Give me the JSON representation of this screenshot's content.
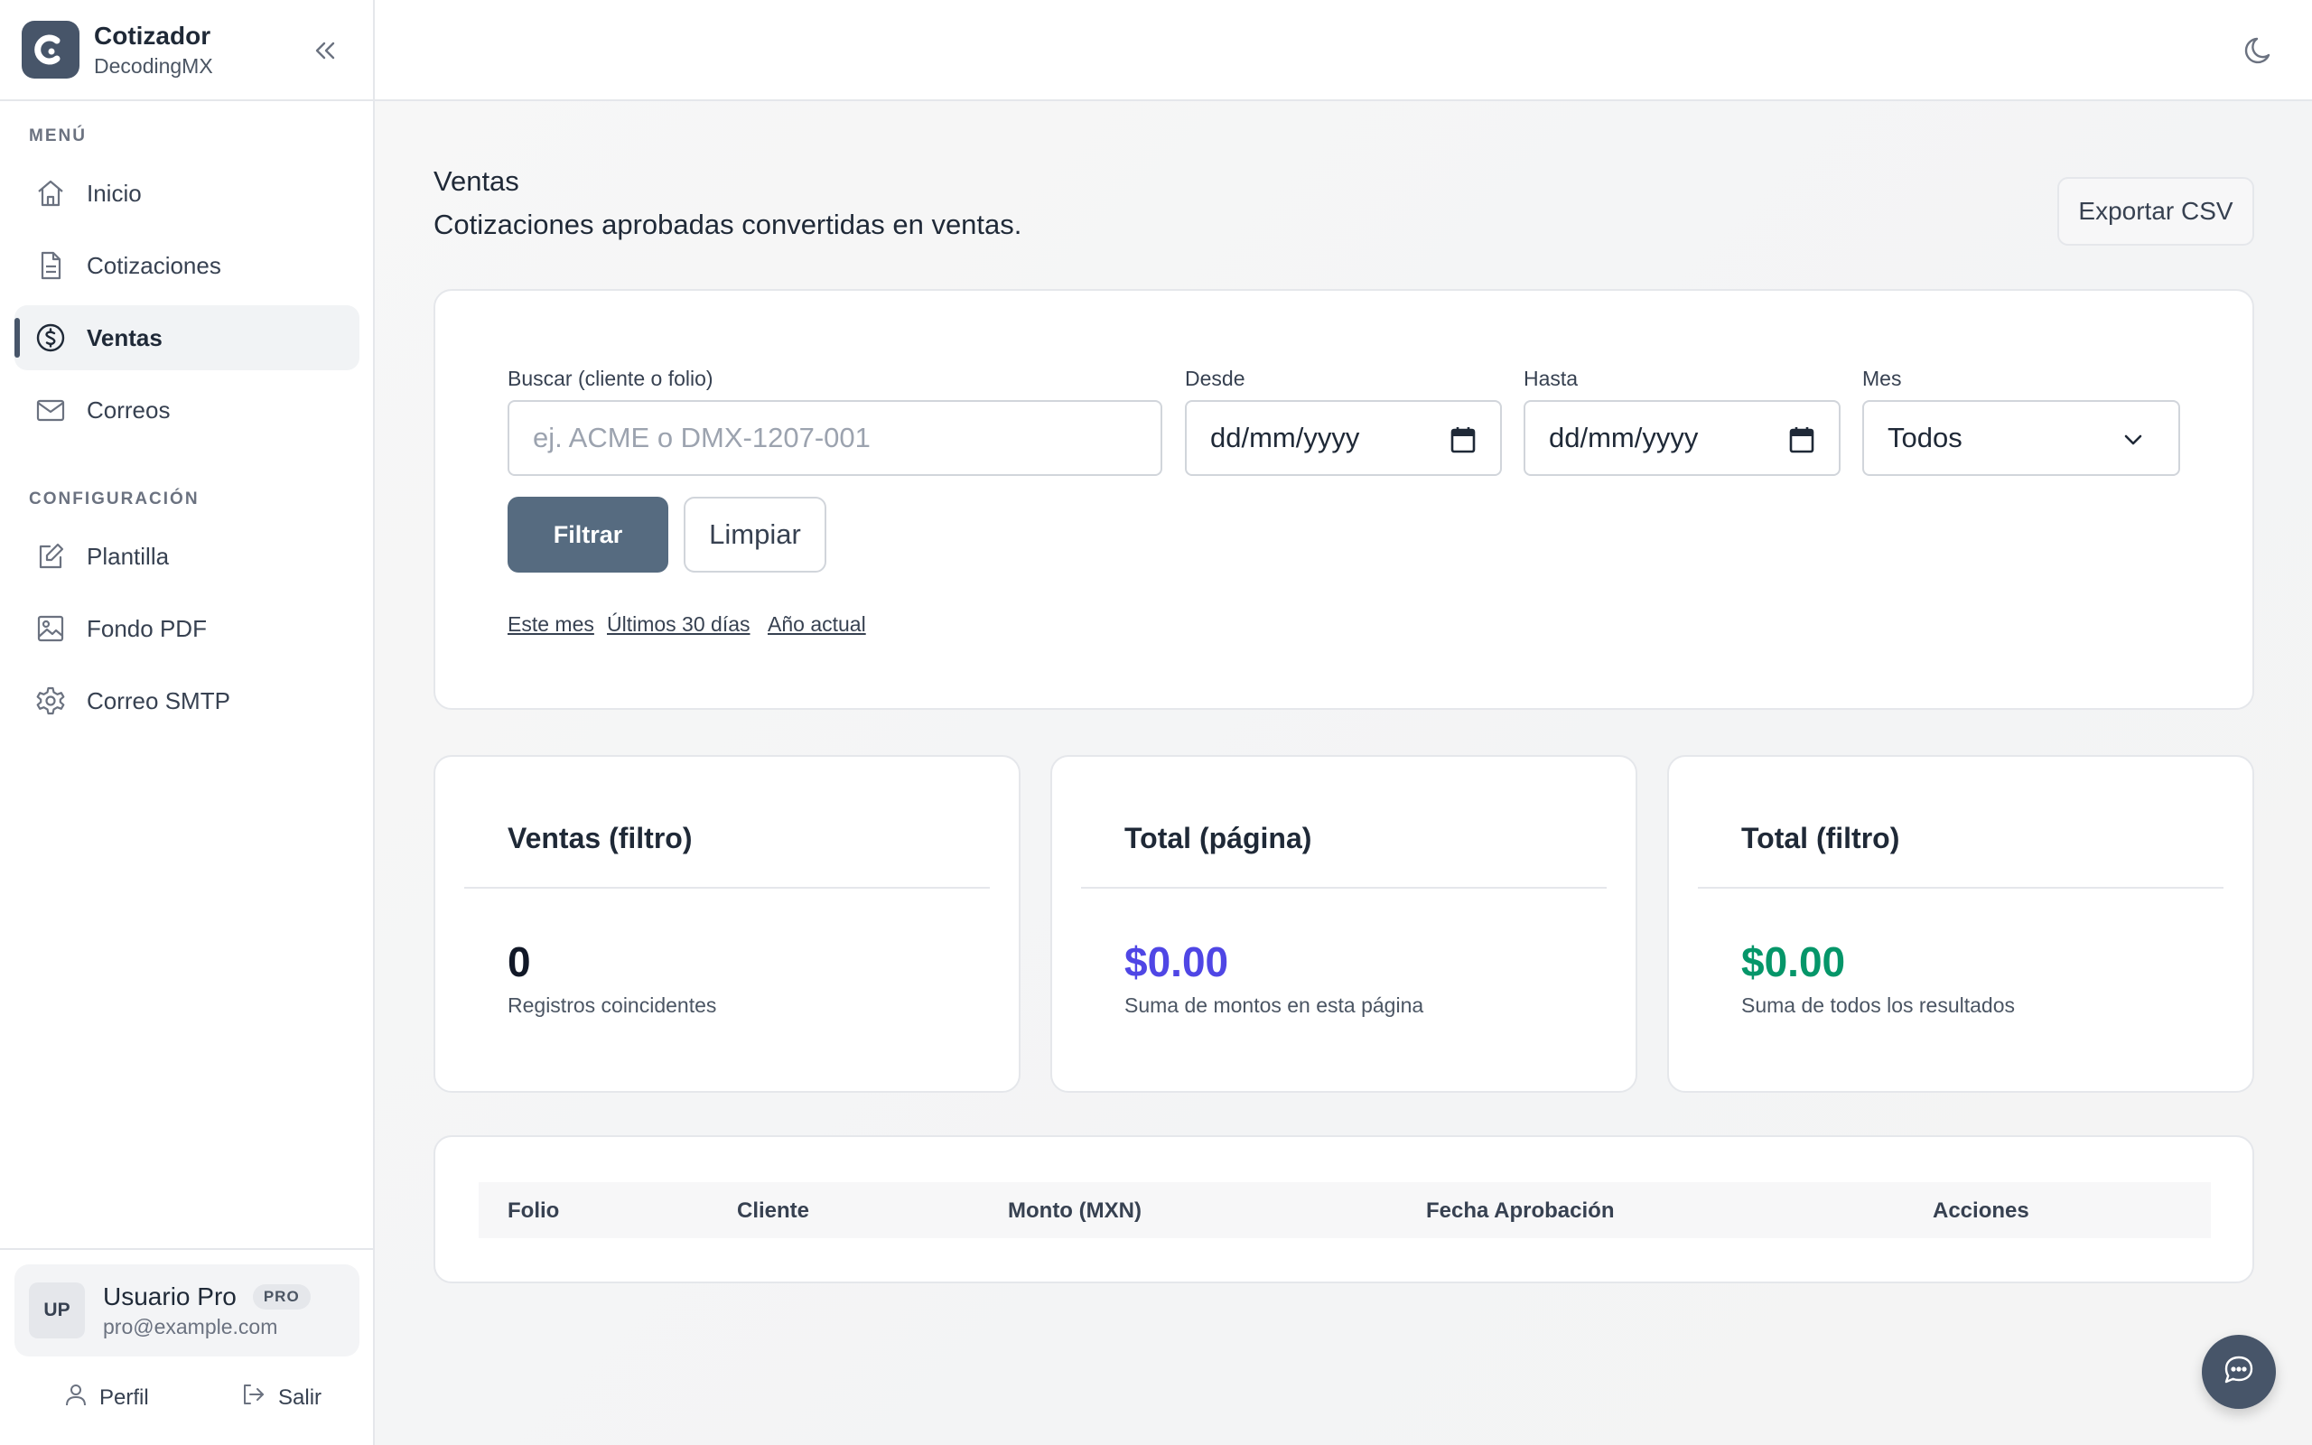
{
  "brand": {
    "title": "Cotizador",
    "subtitle": "DecodingMX"
  },
  "sidebar": {
    "menu_label": "MENÚ",
    "menu_items": [
      {
        "label": "Inicio",
        "icon": "home-icon"
      },
      {
        "label": "Cotizaciones",
        "icon": "document-icon"
      },
      {
        "label": "Ventas",
        "icon": "dollar-circle-icon",
        "active": true
      },
      {
        "label": "Correos",
        "icon": "mail-icon"
      }
    ],
    "config_label": "CONFIGURACIÓN",
    "config_items": [
      {
        "label": "Plantilla",
        "icon": "edit-icon"
      },
      {
        "label": "Fondo PDF",
        "icon": "image-icon"
      },
      {
        "label": "Correo SMTP",
        "icon": "gear-icon"
      }
    ]
  },
  "user": {
    "initials": "UP",
    "name": "Usuario Pro",
    "badge": "PRO",
    "email": "pro@example.com",
    "profile_label": "Perfil",
    "logout_label": "Salir"
  },
  "page": {
    "title": "Ventas",
    "subtitle": "Cotizaciones aprobadas convertidas en ventas.",
    "export_label": "Exportar CSV"
  },
  "filters": {
    "search_label": "Buscar (cliente o folio)",
    "search_placeholder": "ej. ACME o DMX-1207-001",
    "from_label": "Desde",
    "from_value": "dd/mm/yyyy",
    "to_label": "Hasta",
    "to_value": "dd/mm/yyyy",
    "month_label": "Mes",
    "month_value": "Todos",
    "filter_button": "Filtrar",
    "clear_button": "Limpiar",
    "quick_links": [
      "Este mes",
      "Últimos 30 días",
      "Año actual"
    ]
  },
  "stats": [
    {
      "title": "Ventas (filtro)",
      "value": "0",
      "caption": "Registros coincidentes",
      "color": "#111827"
    },
    {
      "title": "Total (página)",
      "value": "$0.00",
      "caption": "Suma de montos en esta página",
      "color": "#4f46e5"
    },
    {
      "title": "Total (filtro)",
      "value": "$0.00",
      "caption": "Suma de todos los resultados",
      "color": "#059669"
    }
  ],
  "table": {
    "columns": [
      "Folio",
      "Cliente",
      "Monto (MXN)",
      "Fecha Aprobación",
      "Acciones"
    ]
  },
  "colors": {
    "accent": "#475569",
    "primary_button": "#566b80"
  }
}
